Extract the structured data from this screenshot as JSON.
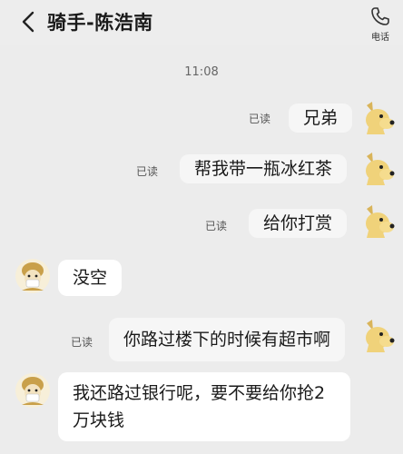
{
  "header": {
    "title": "骑手-陈浩南",
    "back_icon": "chevron-left-icon",
    "phone_icon": "phone-icon",
    "phone_label": "电话"
  },
  "timestamp": "11:08",
  "read_label": "已读",
  "messages": [
    {
      "side": "out",
      "text": "兄弟",
      "read": "已读"
    },
    {
      "side": "out",
      "text": "帮我带一瓶冰红茶",
      "read": "已读"
    },
    {
      "side": "out",
      "text": "给你打赏",
      "read": "已读"
    },
    {
      "side": "in",
      "text": "没空"
    },
    {
      "side": "out",
      "text": "你路过楼下的时候有超市啊",
      "read": "已读"
    },
    {
      "side": "in",
      "text": "我还路过银行呢，要不要给你抢2万块钱"
    }
  ],
  "colors": {
    "background": "#ececec",
    "out_bubble": "#f6f6f6",
    "in_bubble": "#ffffff"
  }
}
